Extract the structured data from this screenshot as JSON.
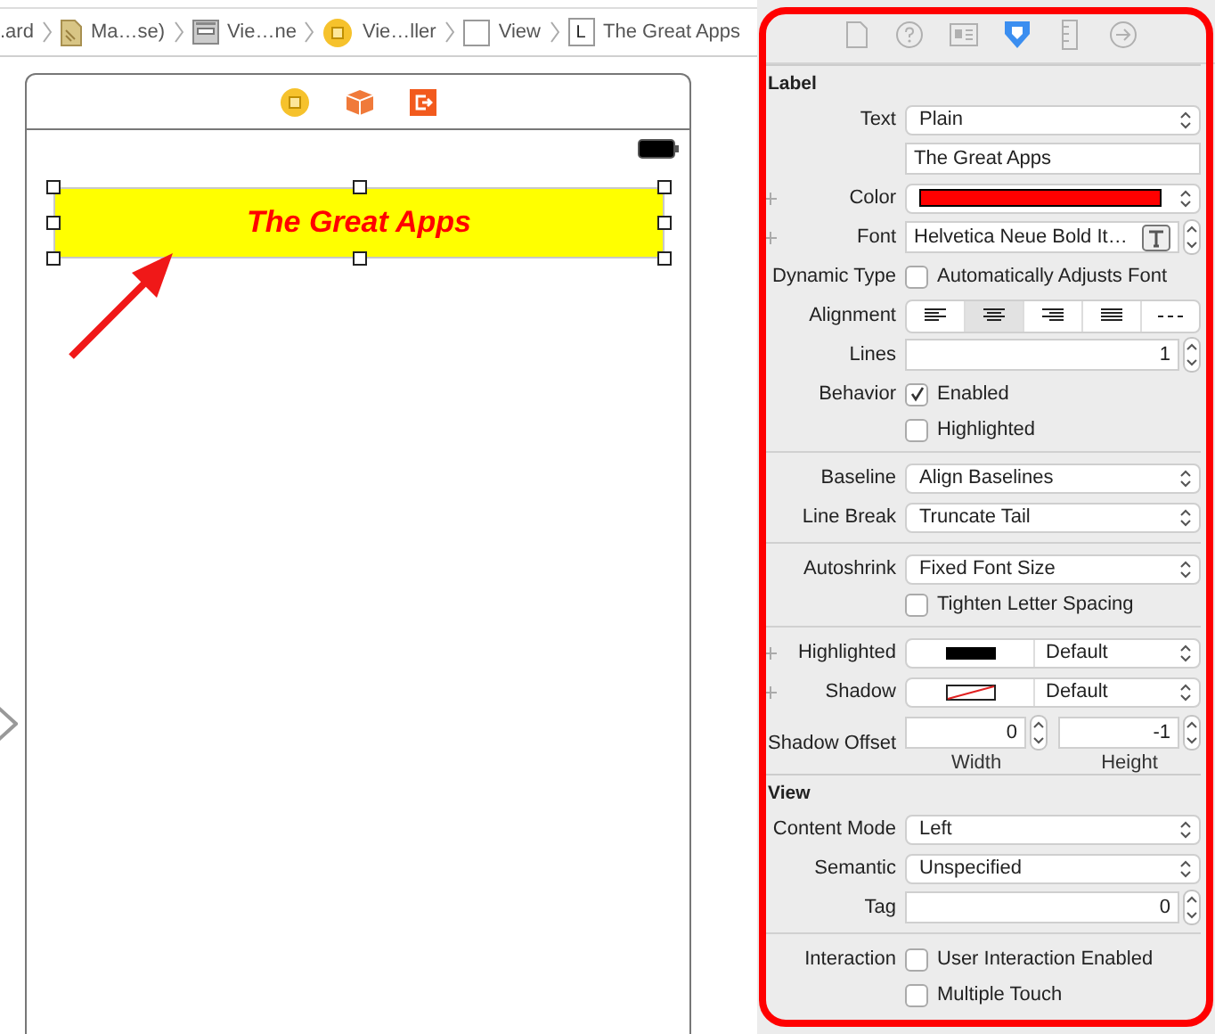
{
  "breadcrumbs": [
    {
      "kind": "none",
      "label": ".ard"
    },
    {
      "kind": "storyboard",
      "label": "Ma…se)"
    },
    {
      "kind": "scene",
      "label": "Vie…ne"
    },
    {
      "kind": "controller",
      "label": "Vie…ller"
    },
    {
      "kind": "view",
      "label": "View"
    },
    {
      "kind": "label",
      "glyph": "L",
      "label": "The Great Apps"
    }
  ],
  "scene_dock": [
    {
      "kind": "controller"
    },
    {
      "kind": "cube"
    },
    {
      "kind": "exit"
    }
  ],
  "canvas_label": {
    "text": "The Great Apps",
    "selected": true
  },
  "inspector": {
    "tabs": [
      {
        "kind": "file",
        "selected": false
      },
      {
        "kind": "help",
        "selected": false
      },
      {
        "kind": "identity",
        "selected": false
      },
      {
        "kind": "attributes",
        "selected": true
      },
      {
        "kind": "size",
        "selected": false
      },
      {
        "kind": "connections",
        "selected": false
      }
    ],
    "sections": [
      {
        "title": "Label",
        "rows": [
          {
            "kind": "popup",
            "label": "Text",
            "value": "Plain"
          },
          {
            "kind": "field",
            "value": "The Great Apps"
          },
          {
            "kind": "color",
            "label": "Color",
            "plus": true,
            "color": "#ff0000"
          },
          {
            "kind": "font",
            "label": "Font",
            "plus": true,
            "value": "Helvetica Neue Bold It…"
          },
          {
            "kind": "check",
            "label": "Dynamic Type",
            "text": "Automatically Adjusts Font",
            "checked": false
          },
          {
            "kind": "align",
            "label": "Alignment",
            "segments": [
              {
                "kind": "left",
                "selected": false
              },
              {
                "kind": "center",
                "selected": true
              },
              {
                "kind": "right",
                "selected": false
              },
              {
                "kind": "justified",
                "selected": false
              },
              {
                "kind": "natural",
                "selected": false
              }
            ]
          },
          {
            "kind": "stepper",
            "label": "Lines",
            "value": "1"
          },
          {
            "kind": "check",
            "label": "Behavior",
            "text": "Enabled",
            "checked": true
          },
          {
            "kind": "check",
            "text": "Highlighted",
            "checked": false
          },
          {
            "kind": "divider"
          },
          {
            "kind": "popup",
            "label": "Baseline",
            "value": "Align Baselines"
          },
          {
            "kind": "popup",
            "label": "Line Break",
            "value": "Truncate Tail"
          },
          {
            "kind": "divider"
          },
          {
            "kind": "popup",
            "label": "Autoshrink",
            "value": "Fixed Font Size"
          },
          {
            "kind": "check",
            "text": "Tighten Letter Spacing",
            "checked": false
          },
          {
            "kind": "divider"
          },
          {
            "kind": "swatch",
            "label": "Highlighted",
            "plus": true,
            "color": "#000000",
            "value": "Default"
          },
          {
            "kind": "swatch",
            "label": "Shadow",
            "plus": true,
            "value": "Default"
          },
          {
            "kind": "offset",
            "label": "Shadow Offset",
            "fields": [
              {
                "value": "0",
                "caption": "Width"
              },
              {
                "value": "-1",
                "caption": "Height"
              }
            ]
          }
        ]
      },
      {
        "title": "View",
        "rows": [
          {
            "kind": "popup",
            "label": "Content Mode",
            "value": "Left"
          },
          {
            "kind": "popup",
            "label": "Semantic",
            "value": "Unspecified"
          },
          {
            "kind": "stepper",
            "label": "Tag",
            "value": "0"
          },
          {
            "kind": "divider"
          },
          {
            "kind": "check",
            "label": "Interaction",
            "text": "User Interaction Enabled",
            "checked": false
          },
          {
            "kind": "check",
            "text": "Multiple Touch",
            "checked": false
          }
        ]
      }
    ]
  }
}
